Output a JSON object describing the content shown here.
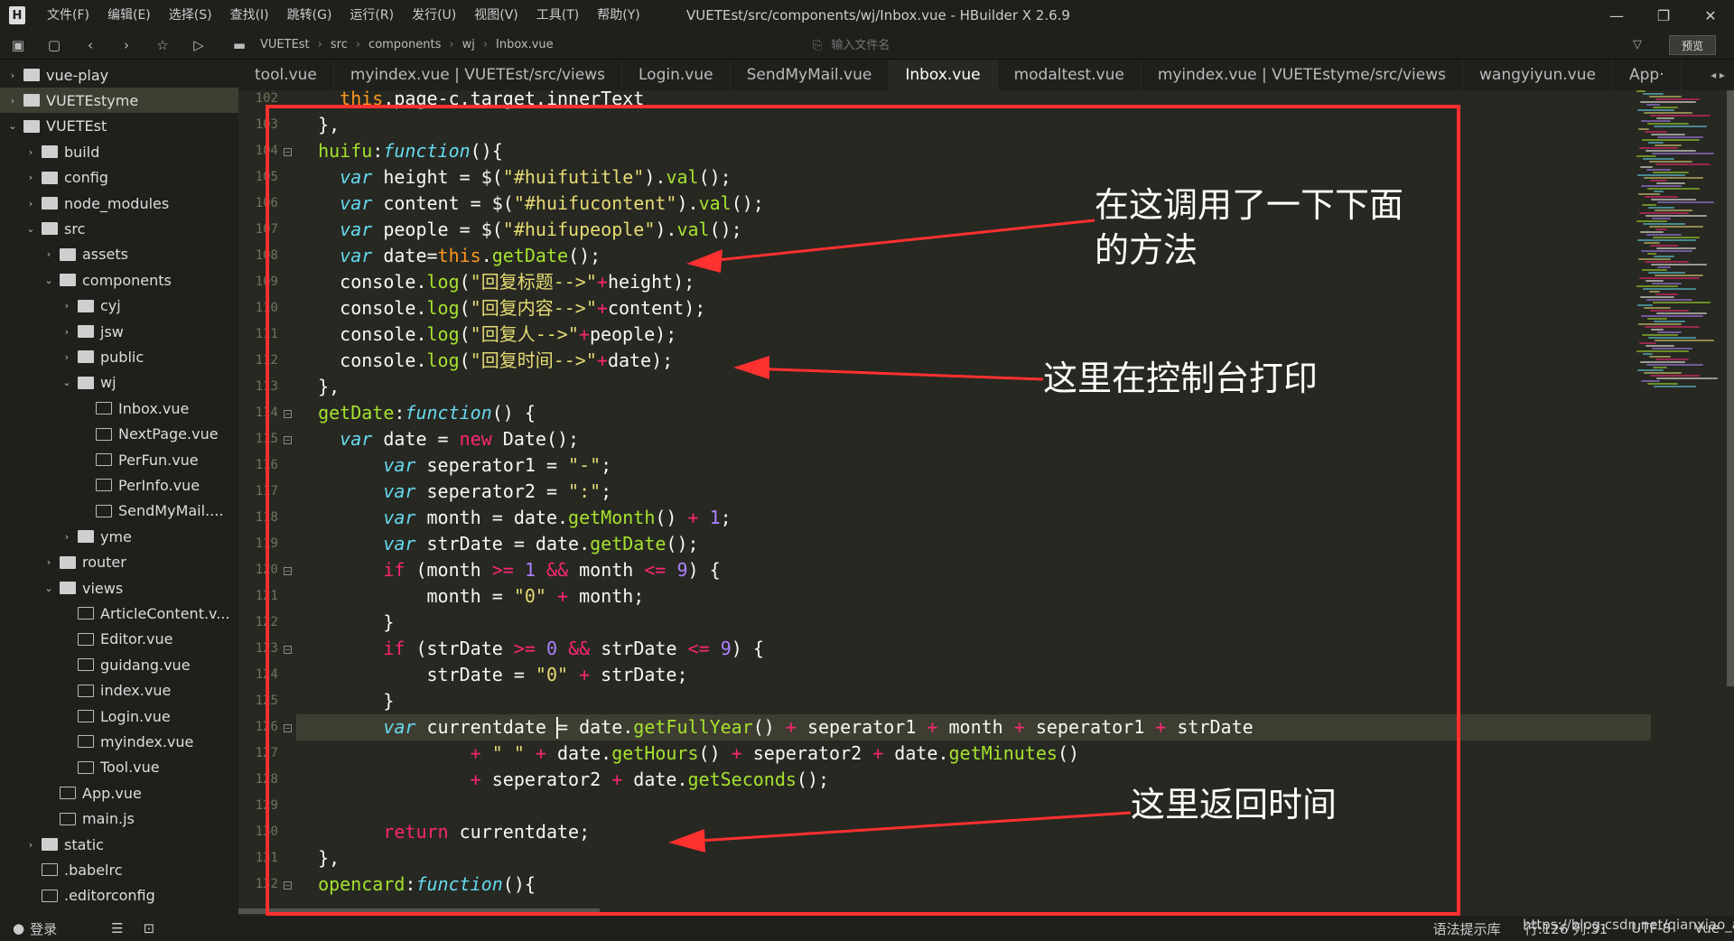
{
  "window": {
    "title": "VUETEst/src/components/wj/Inbox.vue - HBuilder X 2.6.9",
    "logo_icon": "hbuilder-logo-icon",
    "minimize": "—",
    "maximize": "❐",
    "close": "✕"
  },
  "menu": [
    "文件(F)",
    "编辑(E)",
    "选择(S)",
    "查找(I)",
    "跳转(G)",
    "运行(R)",
    "发行(U)",
    "视图(V)",
    "工具(T)",
    "帮助(Y)"
  ],
  "toolbar": {
    "breadcrumbs": [
      "VUETEst",
      "src",
      "components",
      "wj",
      "Inbox.vue"
    ],
    "search_placeholder": "输入文件名",
    "preview_label": "预览"
  },
  "sidebar": {
    "items": [
      {
        "label": "vue-play",
        "type": "folder",
        "depth": 0,
        "expanded": false
      },
      {
        "label": "VUETEstyme",
        "type": "folder",
        "depth": 0,
        "expanded": false,
        "active": true
      },
      {
        "label": "VUETEst",
        "type": "folder",
        "depth": 0,
        "expanded": true
      },
      {
        "label": "build",
        "type": "folder",
        "depth": 1,
        "expanded": false
      },
      {
        "label": "config",
        "type": "folder",
        "depth": 1,
        "expanded": false
      },
      {
        "label": "node_modules",
        "type": "folder",
        "depth": 1,
        "expanded": false
      },
      {
        "label": "src",
        "type": "folder",
        "depth": 1,
        "expanded": true
      },
      {
        "label": "assets",
        "type": "folder",
        "depth": 2,
        "expanded": false
      },
      {
        "label": "components",
        "type": "folder",
        "depth": 2,
        "expanded": true
      },
      {
        "label": "cyj",
        "type": "folder",
        "depth": 3,
        "expanded": false
      },
      {
        "label": "jsw",
        "type": "folder",
        "depth": 3,
        "expanded": false
      },
      {
        "label": "public",
        "type": "folder",
        "depth": 3,
        "expanded": false
      },
      {
        "label": "wj",
        "type": "folder",
        "depth": 3,
        "expanded": true
      },
      {
        "label": "Inbox.vue",
        "type": "file",
        "depth": 4
      },
      {
        "label": "NextPage.vue",
        "type": "file",
        "depth": 4
      },
      {
        "label": "PerFun.vue",
        "type": "file",
        "depth": 4
      },
      {
        "label": "PerInfo.vue",
        "type": "file",
        "depth": 4
      },
      {
        "label": "SendMyMail....",
        "type": "file",
        "depth": 4
      },
      {
        "label": "yme",
        "type": "folder",
        "depth": 3,
        "expanded": false
      },
      {
        "label": "router",
        "type": "folder",
        "depth": 2,
        "expanded": false
      },
      {
        "label": "views",
        "type": "folder",
        "depth": 2,
        "expanded": true
      },
      {
        "label": "ArticleContent.v...",
        "type": "file",
        "depth": 3
      },
      {
        "label": "Editor.vue",
        "type": "file",
        "depth": 3
      },
      {
        "label": "guidang.vue",
        "type": "file",
        "depth": 3
      },
      {
        "label": "index.vue",
        "type": "file",
        "depth": 3
      },
      {
        "label": "Login.vue",
        "type": "file",
        "depth": 3
      },
      {
        "label": "myindex.vue",
        "type": "file",
        "depth": 3
      },
      {
        "label": "Tool.vue",
        "type": "file",
        "depth": 3
      },
      {
        "label": "App.vue",
        "type": "file",
        "depth": 2
      },
      {
        "label": "main.js",
        "type": "file",
        "depth": 2
      },
      {
        "label": "static",
        "type": "folder",
        "depth": 1,
        "expanded": false
      },
      {
        "label": ".babelrc",
        "type": "file",
        "depth": 1
      },
      {
        "label": ".editorconfig",
        "type": "file",
        "depth": 1
      }
    ]
  },
  "tabs": [
    {
      "label": "tool.vue"
    },
    {
      "label": "myindex.vue | VUETEst/src/views"
    },
    {
      "label": "Login.vue"
    },
    {
      "label": "SendMyMail.vue"
    },
    {
      "label": "Inbox.vue",
      "active": true
    },
    {
      "label": "modaltest.vue"
    },
    {
      "label": "myindex.vue | VUETEstyme/src/views"
    },
    {
      "label": "wangyiyun.vue"
    },
    {
      "label": "App·"
    }
  ],
  "editor": {
    "lines": [
      {
        "n": "102",
        "fold": false,
        "t": [
          [
            "    this",
            "th"
          ],
          [
            ".page-c.target.innerText",
            "pl"
          ]
        ]
      },
      {
        "n": "103",
        "fold": false,
        "t": [
          [
            "  },",
            "pl"
          ]
        ]
      },
      {
        "n": "104",
        "fold": true,
        "t": [
          [
            "  huifu",
            "fn"
          ],
          [
            ":",
            "pl"
          ],
          [
            "function",
            "kw"
          ],
          [
            "(){",
            "pl"
          ]
        ]
      },
      {
        "n": "105",
        "fold": false,
        "t": [
          [
            "    ",
            "pl"
          ],
          [
            "var",
            "kw"
          ],
          [
            " height = $(",
            "pl"
          ],
          [
            "\"#huifutitle\"",
            "st"
          ],
          [
            ").",
            "pl"
          ],
          [
            "val",
            "fn"
          ],
          [
            "();",
            "pl"
          ]
        ]
      },
      {
        "n": "106",
        "fold": false,
        "t": [
          [
            "    ",
            "pl"
          ],
          [
            "var",
            "kw"
          ],
          [
            " content = $(",
            "pl"
          ],
          [
            "\"#huifucontent\"",
            "st"
          ],
          [
            ").",
            "pl"
          ],
          [
            "val",
            "fn"
          ],
          [
            "();",
            "pl"
          ]
        ]
      },
      {
        "n": "107",
        "fold": false,
        "t": [
          [
            "    ",
            "pl"
          ],
          [
            "var",
            "kw"
          ],
          [
            " people = $(",
            "pl"
          ],
          [
            "\"#huifupeople\"",
            "st"
          ],
          [
            ").",
            "pl"
          ],
          [
            "val",
            "fn"
          ],
          [
            "();",
            "pl"
          ]
        ]
      },
      {
        "n": "108",
        "fold": false,
        "t": [
          [
            "    ",
            "pl"
          ],
          [
            "var",
            "kw"
          ],
          [
            " date=",
            "pl"
          ],
          [
            "this",
            "th"
          ],
          [
            ".",
            "pl"
          ],
          [
            "getDate",
            "fn"
          ],
          [
            "();",
            "pl"
          ]
        ]
      },
      {
        "n": "109",
        "fold": false,
        "t": [
          [
            "    console.",
            "pl"
          ],
          [
            "log",
            "fn"
          ],
          [
            "(",
            "pl"
          ],
          [
            "\"回复标题-->\"",
            "st"
          ],
          [
            "+",
            "op"
          ],
          [
            "height);",
            "pl"
          ]
        ]
      },
      {
        "n": "110",
        "fold": false,
        "t": [
          [
            "    console.",
            "pl"
          ],
          [
            "log",
            "fn"
          ],
          [
            "(",
            "pl"
          ],
          [
            "\"回复内容-->\"",
            "st"
          ],
          [
            "+",
            "op"
          ],
          [
            "content);",
            "pl"
          ]
        ]
      },
      {
        "n": "111",
        "fold": false,
        "t": [
          [
            "    console.",
            "pl"
          ],
          [
            "log",
            "fn"
          ],
          [
            "(",
            "pl"
          ],
          [
            "\"回复人-->\"",
            "st"
          ],
          [
            "+",
            "op"
          ],
          [
            "people);",
            "pl"
          ]
        ]
      },
      {
        "n": "112",
        "fold": false,
        "t": [
          [
            "    console.",
            "pl"
          ],
          [
            "log",
            "fn"
          ],
          [
            "(",
            "pl"
          ],
          [
            "\"回复时间-->\"",
            "st"
          ],
          [
            "+",
            "op"
          ],
          [
            "date);",
            "pl"
          ]
        ]
      },
      {
        "n": "113",
        "fold": false,
        "t": [
          [
            "  },",
            "pl"
          ]
        ]
      },
      {
        "n": "114",
        "fold": true,
        "t": [
          [
            "  getDate",
            "fn"
          ],
          [
            ":",
            "pl"
          ],
          [
            "function",
            "kw"
          ],
          [
            "() {",
            "pl"
          ]
        ]
      },
      {
        "n": "115",
        "fold": true,
        "t": [
          [
            "    ",
            "pl"
          ],
          [
            "var",
            "kw"
          ],
          [
            " date = ",
            "pl"
          ],
          [
            "new",
            "op"
          ],
          [
            " Date();",
            "pl"
          ]
        ]
      },
      {
        "n": "116",
        "fold": false,
        "t": [
          [
            "        ",
            "pl"
          ],
          [
            "var",
            "kw"
          ],
          [
            " seperator1 = ",
            "pl"
          ],
          [
            "\"-\"",
            "st"
          ],
          [
            ";",
            "pl"
          ]
        ]
      },
      {
        "n": "117",
        "fold": false,
        "t": [
          [
            "        ",
            "pl"
          ],
          [
            "var",
            "kw"
          ],
          [
            " seperator2 = ",
            "pl"
          ],
          [
            "\":\"",
            "st"
          ],
          [
            ";",
            "pl"
          ]
        ]
      },
      {
        "n": "118",
        "fold": false,
        "t": [
          [
            "        ",
            "pl"
          ],
          [
            "var",
            "kw"
          ],
          [
            " month = date.",
            "pl"
          ],
          [
            "getMonth",
            "fn"
          ],
          [
            "() ",
            "pl"
          ],
          [
            "+",
            "op"
          ],
          [
            " ",
            "pl"
          ],
          [
            "1",
            "nm"
          ],
          [
            ";",
            "pl"
          ]
        ]
      },
      {
        "n": "119",
        "fold": false,
        "t": [
          [
            "        ",
            "pl"
          ],
          [
            "var",
            "kw"
          ],
          [
            " strDate = date.",
            "pl"
          ],
          [
            "getDate",
            "fn"
          ],
          [
            "();",
            "pl"
          ]
        ]
      },
      {
        "n": "120",
        "fold": true,
        "t": [
          [
            "        ",
            "pl"
          ],
          [
            "if",
            "op"
          ],
          [
            " (month ",
            "pl"
          ],
          [
            ">=",
            "op"
          ],
          [
            " ",
            "pl"
          ],
          [
            "1",
            "nm"
          ],
          [
            " ",
            "pl"
          ],
          [
            "&&",
            "op"
          ],
          [
            " month ",
            "pl"
          ],
          [
            "<=",
            "op"
          ],
          [
            " ",
            "pl"
          ],
          [
            "9",
            "nm"
          ],
          [
            ") {",
            "pl"
          ]
        ]
      },
      {
        "n": "121",
        "fold": false,
        "t": [
          [
            "            month = ",
            "pl"
          ],
          [
            "\"0\"",
            "st"
          ],
          [
            " ",
            "pl"
          ],
          [
            "+",
            "op"
          ],
          [
            " month;",
            "pl"
          ]
        ]
      },
      {
        "n": "122",
        "fold": false,
        "t": [
          [
            "        }",
            "pl"
          ]
        ]
      },
      {
        "n": "123",
        "fold": true,
        "t": [
          [
            "        ",
            "pl"
          ],
          [
            "if",
            "op"
          ],
          [
            " (strDate ",
            "pl"
          ],
          [
            ">=",
            "op"
          ],
          [
            " ",
            "pl"
          ],
          [
            "0",
            "nm"
          ],
          [
            " ",
            "pl"
          ],
          [
            "&&",
            "op"
          ],
          [
            " strDate ",
            "pl"
          ],
          [
            "<=",
            "op"
          ],
          [
            " ",
            "pl"
          ],
          [
            "9",
            "nm"
          ],
          [
            ") {",
            "pl"
          ]
        ]
      },
      {
        "n": "124",
        "fold": false,
        "t": [
          [
            "            strDate = ",
            "pl"
          ],
          [
            "\"0\"",
            "st"
          ],
          [
            " ",
            "pl"
          ],
          [
            "+",
            "op"
          ],
          [
            " strDate;",
            "pl"
          ]
        ]
      },
      {
        "n": "125",
        "fold": false,
        "t": [
          [
            "        }",
            "pl"
          ]
        ]
      },
      {
        "n": "126",
        "fold": true,
        "current": true,
        "t": [
          [
            "        ",
            "pl"
          ],
          [
            "var",
            "kw"
          ],
          [
            " currentdate = date.",
            "pl"
          ],
          [
            "getFullYear",
            "fn"
          ],
          [
            "() ",
            "pl"
          ],
          [
            "+",
            "op"
          ],
          [
            " seperator1 ",
            "pl"
          ],
          [
            "+",
            "op"
          ],
          [
            " month ",
            "pl"
          ],
          [
            "+",
            "op"
          ],
          [
            " seperator1 ",
            "pl"
          ],
          [
            "+",
            "op"
          ],
          [
            " strDate",
            "pl"
          ]
        ]
      },
      {
        "n": "127",
        "fold": false,
        "t": [
          [
            "                ",
            "pl"
          ],
          [
            "+",
            "op"
          ],
          [
            " ",
            "pl"
          ],
          [
            "\" \"",
            "st"
          ],
          [
            " ",
            "pl"
          ],
          [
            "+",
            "op"
          ],
          [
            " date.",
            "pl"
          ],
          [
            "getHours",
            "fn"
          ],
          [
            "() ",
            "pl"
          ],
          [
            "+",
            "op"
          ],
          [
            " seperator2 ",
            "pl"
          ],
          [
            "+",
            "op"
          ],
          [
            " date.",
            "pl"
          ],
          [
            "getMinutes",
            "fn"
          ],
          [
            "()",
            "pl"
          ]
        ]
      },
      {
        "n": "128",
        "fold": false,
        "t": [
          [
            "                ",
            "pl"
          ],
          [
            "+",
            "op"
          ],
          [
            " seperator2 ",
            "pl"
          ],
          [
            "+",
            "op"
          ],
          [
            " date.",
            "pl"
          ],
          [
            "getSeconds",
            "fn"
          ],
          [
            "();",
            "pl"
          ]
        ]
      },
      {
        "n": "129",
        "fold": false,
        "t": [
          [
            "",
            "pl"
          ]
        ]
      },
      {
        "n": "130",
        "fold": false,
        "t": [
          [
            "        ",
            "pl"
          ],
          [
            "return",
            "op"
          ],
          [
            " currentdate;",
            "pl"
          ]
        ]
      },
      {
        "n": "131",
        "fold": false,
        "t": [
          [
            "  },",
            "pl"
          ]
        ]
      },
      {
        "n": "132",
        "fold": true,
        "t": [
          [
            "  opencard",
            "fn"
          ],
          [
            ":",
            "pl"
          ],
          [
            "function",
            "kw"
          ],
          [
            "(){",
            "pl"
          ]
        ]
      }
    ]
  },
  "annotations": {
    "call_line1": "在这调用了一下下面",
    "call_line2": "的方法",
    "console": "这里在控制台打印",
    "return_time": "这里返回时间"
  },
  "colors": {
    "annotation_border": "#ff3030",
    "editor_bg": "#272822"
  },
  "status": {
    "login": "登录",
    "syntax_hint": "语法提示库",
    "cursor_pos": "行:126  列:31",
    "encoding": "UTF-8",
    "language": "Vue",
    "watermark": "https://blog.csdn.net/qianxiao_a"
  }
}
